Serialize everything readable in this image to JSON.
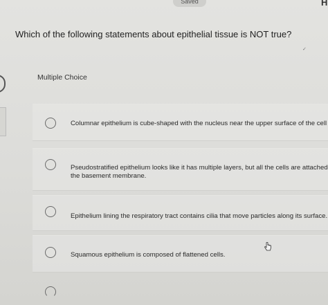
{
  "header": {
    "saved_label": "Saved",
    "corner_letter": "H"
  },
  "question": {
    "text": "Which of the following statements about epithelial tissue is NOT true?"
  },
  "section": {
    "label": "Multiple Choice"
  },
  "options": [
    {
      "lines": [
        "Columnar epithelium is cube-shaped with the nucleus near the upper surface of the cell"
      ],
      "selected": false
    },
    {
      "lines": [
        "Pseudostratified epithelium looks like it has multiple layers, but all the cells are attached",
        "the basement membrane."
      ],
      "selected": false
    },
    {
      "lines": [
        "Epithelium lining the respiratory tract contains cilia that move particles along its surface."
      ],
      "selected": false
    },
    {
      "lines": [
        "Squamous epithelium is composed of flattened cells."
      ],
      "selected": false
    }
  ],
  "icons": {
    "cursor": "hand-pointer-icon",
    "radio": "radio-button-icon"
  },
  "colors": {
    "background": "#dcdcd9",
    "text": "#2a2a2a",
    "radio_border": "#6a6a6a"
  }
}
